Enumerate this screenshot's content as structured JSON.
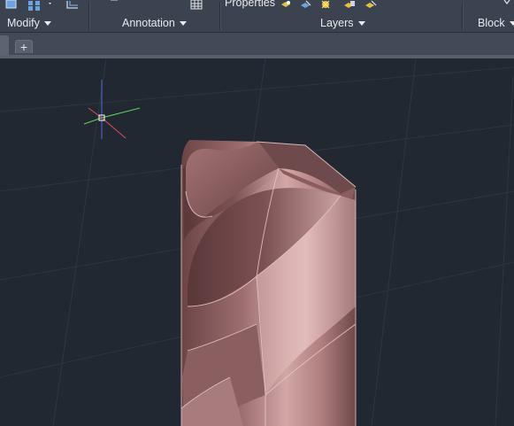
{
  "ribbon": {
    "panels": [
      {
        "label": "Modify",
        "dropdown": "chevron-down-icon"
      },
      {
        "label": "Annotation",
        "dropdown": "chevron-down-icon"
      },
      {
        "label": "Layers",
        "dropdown": "chevron-down-icon"
      },
      {
        "label": "Block",
        "dropdown": "chevron-down-icon"
      }
    ],
    "properties_label": "Properties"
  },
  "tabs": {
    "new_tab_label": "+"
  },
  "viewport": {
    "background": "#212831",
    "model_color": "#b68787",
    "ucs_colors": {
      "x": "#d94f5c",
      "y": "#5fd35f",
      "z": "#4a6bd8"
    }
  }
}
